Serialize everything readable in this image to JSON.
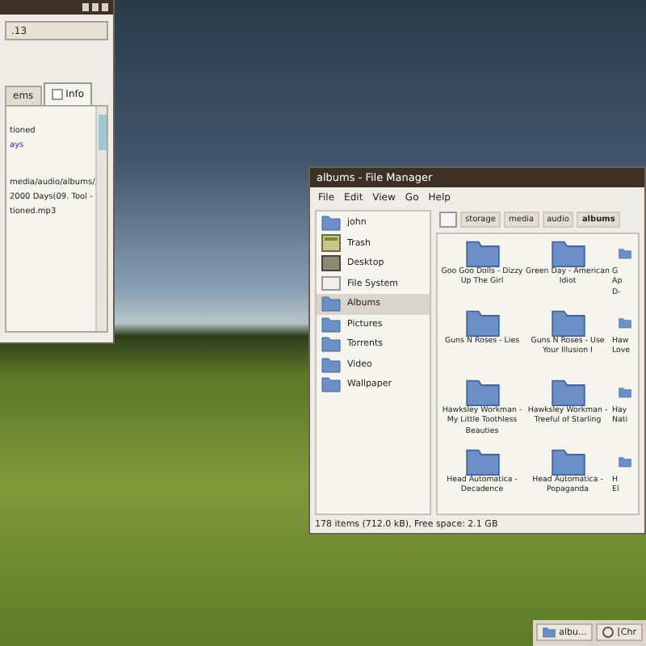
{
  "left_window": {
    "field_value": ".13",
    "tabs": [
      {
        "label": "ems",
        "selected": false
      },
      {
        "label": "Info",
        "selected": true
      }
    ],
    "info_lines": [
      {
        "text": "tioned",
        "kind": "plain"
      },
      {
        "text": "ays",
        "kind": "link"
      },
      {
        "text": "media/audio/albums/",
        "kind": "plain"
      },
      {
        "text": "2000 Days(09. Tool -",
        "kind": "plain"
      },
      {
        "text": "tioned.mp3",
        "kind": "plain"
      }
    ]
  },
  "file_manager": {
    "title": "albums - File Manager",
    "menu": [
      "File",
      "Edit",
      "View",
      "Go",
      "Help"
    ],
    "sidebar": [
      {
        "label": "john",
        "kind": "home",
        "selected": false
      },
      {
        "label": "Trash",
        "kind": "trash",
        "selected": false
      },
      {
        "label": "Desktop",
        "kind": "desktop",
        "selected": false
      },
      {
        "label": "File System",
        "kind": "drive",
        "selected": false
      },
      {
        "label": "Albums",
        "kind": "folder",
        "selected": true
      },
      {
        "label": "Pictures",
        "kind": "folder",
        "selected": false
      },
      {
        "label": "Torrents",
        "kind": "folder",
        "selected": false
      },
      {
        "label": "Video",
        "kind": "folder",
        "selected": false
      },
      {
        "label": "Wallpaper",
        "kind": "folder",
        "selected": false
      }
    ],
    "path": [
      {
        "label": "storage",
        "selected": false
      },
      {
        "label": "media",
        "selected": false
      },
      {
        "label": "audio",
        "selected": false
      },
      {
        "label": "albums",
        "selected": true
      }
    ],
    "items": [
      {
        "lines": [
          "Goo Goo Dolls - Dizzy",
          "Up The Girl"
        ]
      },
      {
        "lines": [
          "Green Day - American",
          "Idiot"
        ]
      },
      {
        "lines": [
          "G",
          "Ap",
          "D-"
        ]
      },
      {
        "lines": [
          "Guns N Roses - Lies"
        ]
      },
      {
        "lines": [
          "Guns N Roses - Use",
          "Your Illusion I"
        ]
      },
      {
        "lines": [
          "Haw",
          "Love"
        ]
      },
      {
        "lines": [
          "Hawksley Workman -",
          "My Little Toothless",
          "Beauties"
        ]
      },
      {
        "lines": [
          "Hawksley Workman -",
          "Treeful of Starling"
        ]
      },
      {
        "lines": [
          "Hay",
          "Nati"
        ]
      },
      {
        "lines": [
          "Head Automatica -",
          "Decadence"
        ]
      },
      {
        "lines": [
          "Head Automatica -",
          "Popaganda"
        ]
      },
      {
        "lines": [
          "H",
          "El"
        ]
      }
    ],
    "status": "178 items (712.0 kB), Free space: 2.1 GB"
  },
  "taskbar": [
    {
      "label": "albu...",
      "kind": "folder"
    },
    {
      "label": "[Chr",
      "kind": "clock"
    }
  ]
}
